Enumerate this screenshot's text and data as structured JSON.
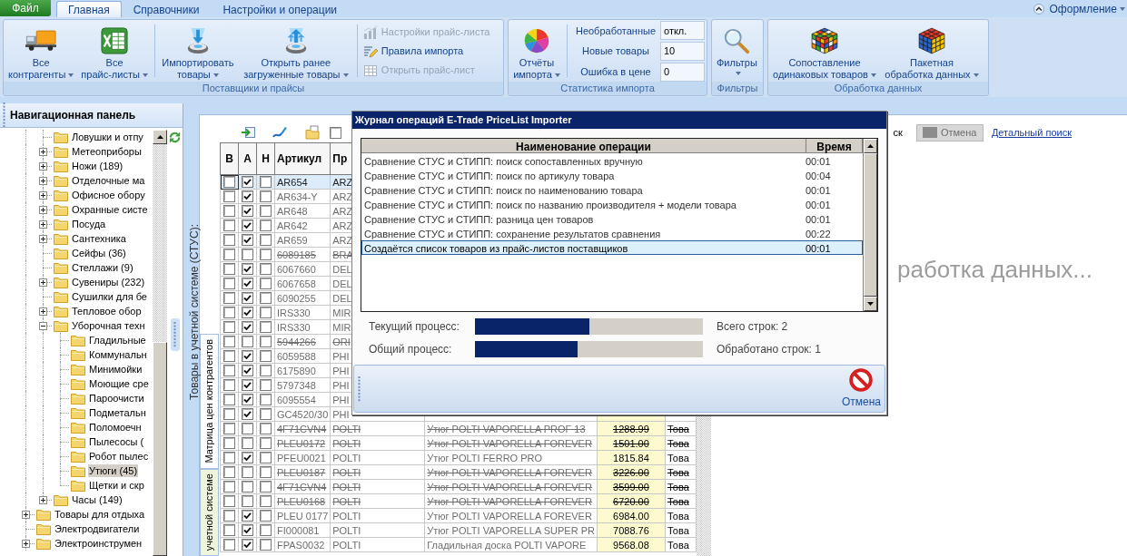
{
  "file_button": {
    "label": "Файл"
  },
  "tabs": [
    {
      "label": "Главная",
      "selected": true
    },
    {
      "label": "Справочники",
      "selected": false
    },
    {
      "label": "Настройки и операции",
      "selected": false
    }
  ],
  "appearance_menu": {
    "label": "Оформление"
  },
  "ribbon": [
    {
      "title": "Поставщики и прайсы",
      "sections": [
        {
          "kind": "large",
          "buttons": [
            {
              "lines": [
                "Все",
                "контрагенты"
              ]
            },
            {
              "lines": [
                "Все",
                "прайс-листы"
              ]
            }
          ]
        },
        {
          "kind": "large",
          "buttons": [
            {
              "lines": [
                "Импортировать",
                "товары"
              ]
            },
            {
              "lines": [
                "Открыть ранее",
                "загруженные товары"
              ]
            }
          ]
        },
        {
          "kind": "small",
          "buttons": [
            {
              "label": "Настройки прайс-листа",
              "disabled": true
            },
            {
              "label": "Правила импорта",
              "disabled": false
            },
            {
              "label": "Открыть прайс-лист",
              "disabled": true
            }
          ]
        }
      ]
    },
    {
      "title": "Статистика импорта",
      "sections": [
        {
          "kind": "large",
          "buttons": [
            {
              "lines": [
                "Отчёты",
                "импорта"
              ]
            }
          ]
        },
        {
          "kind": "fields",
          "fields": [
            {
              "label": "Необработанные",
              "value": "откл."
            },
            {
              "label": "Новые товары",
              "value": "10"
            },
            {
              "label": "Ошибка в цене",
              "value": "0"
            }
          ]
        }
      ]
    },
    {
      "title": "Фильтры",
      "sections": [
        {
          "kind": "large",
          "buttons": [
            {
              "lines": [
                "Фильтры"
              ]
            }
          ]
        }
      ]
    },
    {
      "title": "Обработка данных",
      "sections": [
        {
          "kind": "large",
          "buttons": [
            {
              "lines": [
                "Сопоставление",
                "одинаковых товаров"
              ]
            },
            {
              "lines": [
                "Пакетная",
                "обработка данных"
              ]
            }
          ]
        }
      ]
    }
  ],
  "navigation": {
    "title": "Навигационная панель",
    "tree": [
      {
        "children": [
          {
            "label": "Ловушки и отпу",
            "selected": false
          },
          {
            "label": "Метеоприборы",
            "expanded": false,
            "selected": false
          },
          {
            "label": "Ножи (189)",
            "expanded": false,
            "selected": false
          },
          {
            "label": "Отделочные ма",
            "expanded": false,
            "selected": false
          },
          {
            "label": "Офисное обору",
            "expanded": false,
            "selected": false
          },
          {
            "label": "Охранные систе",
            "expanded": false,
            "selected": false
          },
          {
            "label": "Посуда",
            "expanded": false,
            "selected": false
          },
          {
            "label": "Сантехника",
            "expanded": false,
            "selected": false
          },
          {
            "label": "Сейфы (36)",
            "selected": false
          },
          {
            "label": "Стеллажи (9)",
            "selected": false
          },
          {
            "label": "Сувениры (232)",
            "expanded": false,
            "selected": false
          },
          {
            "label": "Сушилки для бе",
            "selected": false
          },
          {
            "label": "Тепловое обор",
            "expanded": false,
            "selected": false
          },
          {
            "label": "Уборочная техн",
            "expanded": true,
            "selected": false,
            "children": [
              {
                "label": "Гладильные",
                "selected": false
              },
              {
                "label": "Коммунальн",
                "selected": false
              },
              {
                "label": "Минимойки",
                "selected": false
              },
              {
                "label": "Моющие сре",
                "selected": false
              },
              {
                "label": "Пароочисти",
                "selected": false
              },
              {
                "label": "Подметальн",
                "selected": false
              },
              {
                "label": "Поломоечн",
                "selected": false
              },
              {
                "label": "Пылесосы (",
                "selected": false
              },
              {
                "label": "Робот пылес",
                "selected": false
              },
              {
                "label": "Утюги (45)",
                "selected": true
              },
              {
                "label": "Щетки и скр",
                "selected": false
              }
            ]
          },
          {
            "label": "Часы (149)",
            "expanded": false,
            "selected": false
          }
        ]
      },
      {
        "label": "Товары для отдыха",
        "expanded": false,
        "selected": false
      },
      {
        "label": "Электродвигатели",
        "selected": false
      },
      {
        "label": "Электроинструмен",
        "expanded": false,
        "selected": false
      }
    ]
  },
  "main": {
    "side_label": "Товары в учетной системе (СТУС):",
    "side_tabs": [
      {
        "label": "Матрица цен контрагентов",
        "selected": true
      },
      {
        "label": "учетной системе",
        "selected": false
      }
    ],
    "toolbar": {
      "checkbox": {
        "checked": false
      },
      "search_label": "ск",
      "cancel_button": {
        "label": "Отмена",
        "disabled": true
      },
      "detail_search_link": "Детальный поиск"
    },
    "status_text": "работка данных...",
    "table": {
      "check_columns": [
        "В",
        "А",
        "Н"
      ],
      "columns": [
        "Артикул",
        "Пр"
      ],
      "rows": [
        {
          "checks": [
            false,
            true,
            false
          ],
          "cells": [
            "AR654",
            "ARZ"
          ],
          "crossed_out": false,
          "selected": true
        },
        {
          "checks": [
            false,
            true,
            false
          ],
          "cells": [
            "AR634-Y",
            "ARZ"
          ],
          "crossed_out": false,
          "selected": false
        },
        {
          "checks": [
            false,
            true,
            false
          ],
          "cells": [
            "AR648",
            "ARZ"
          ],
          "crossed_out": false,
          "selected": false
        },
        {
          "checks": [
            false,
            true,
            false
          ],
          "cells": [
            "AR642",
            "ARZ"
          ],
          "crossed_out": false,
          "selected": false
        },
        {
          "checks": [
            false,
            true,
            false
          ],
          "cells": [
            "AR659",
            "ARZ"
          ],
          "crossed_out": false,
          "selected": false
        },
        {
          "checks": [
            false,
            false,
            false
          ],
          "cells": [
            "6089185",
            "BRA"
          ],
          "crossed_out": true,
          "selected": false
        },
        {
          "checks": [
            false,
            true,
            false
          ],
          "cells": [
            "6067660",
            "DEL"
          ],
          "crossed_out": false,
          "selected": false
        },
        {
          "checks": [
            false,
            true,
            false
          ],
          "cells": [
            "6067658",
            "DEL"
          ],
          "crossed_out": false,
          "selected": false
        },
        {
          "checks": [
            false,
            true,
            false
          ],
          "cells": [
            "6090255",
            "DEL"
          ],
          "crossed_out": false,
          "selected": false
        },
        {
          "checks": [
            false,
            true,
            false
          ],
          "cells": [
            "IRS330",
            "MIR"
          ],
          "crossed_out": false,
          "selected": false
        },
        {
          "checks": [
            false,
            true,
            false
          ],
          "cells": [
            "IRS330",
            "MIR"
          ],
          "crossed_out": false,
          "selected": false
        },
        {
          "checks": [
            false,
            false,
            false
          ],
          "cells": [
            "5944266",
            "ORI"
          ],
          "crossed_out": true,
          "selected": false
        },
        {
          "checks": [
            false,
            true,
            false
          ],
          "cells": [
            "6059588",
            "PHI"
          ],
          "crossed_out": false,
          "selected": false
        },
        {
          "checks": [
            false,
            true,
            false
          ],
          "cells": [
            "6175890",
            "PHI"
          ],
          "crossed_out": false,
          "selected": false
        },
        {
          "checks": [
            false,
            true,
            false
          ],
          "cells": [
            "5797348",
            "PHI"
          ],
          "crossed_out": false,
          "selected": false
        },
        {
          "checks": [
            false,
            true,
            false
          ],
          "cells": [
            "6095554",
            "PHI"
          ],
          "crossed_out": false,
          "selected": false
        },
        {
          "checks": [
            false,
            true,
            false
          ],
          "cells": [
            "GC4520/30",
            "PHI"
          ],
          "crossed_out": false,
          "selected": false
        },
        {
          "checks": [
            false,
            false,
            false
          ],
          "cells": [
            "4F71CVN4",
            "POLTI",
            "Утюг POLTI VAPORELLA PROF 13",
            "1288.99",
            "Това"
          ],
          "crossed_out": true,
          "selected": false
        },
        {
          "checks": [
            false,
            false,
            false
          ],
          "cells": [
            "PLEU0172",
            "POLTI",
            "Утюг POLTI VAPORELLA FOREVER",
            "1501.00",
            "Това"
          ],
          "crossed_out": true,
          "selected": false
        },
        {
          "checks": [
            false,
            true,
            false
          ],
          "cells": [
            "PFEU0021",
            "POLTI",
            "Утюг POLTI FERRO PRO",
            "1815.84",
            "Това"
          ],
          "crossed_out": false,
          "selected": false
        },
        {
          "checks": [
            false,
            false,
            false
          ],
          "cells": [
            "PLEU0187",
            "POLTI",
            "Утюг POLTI VAPORELLA FOREVER",
            "3226.00",
            "Това"
          ],
          "crossed_out": true,
          "selected": false
        },
        {
          "checks": [
            false,
            false,
            false
          ],
          "cells": [
            "4F71CVN4",
            "POLTI",
            "Утюг POLTI VAPORELLA FOREVER",
            "3599.00",
            "Това"
          ],
          "crossed_out": true,
          "selected": false
        },
        {
          "checks": [
            false,
            false,
            false
          ],
          "cells": [
            "PLEU0168",
            "POLTI",
            "Утюг POLTI VAPORELLA FOREVER",
            "6720.00",
            "Това"
          ],
          "crossed_out": true,
          "selected": false
        },
        {
          "checks": [
            false,
            true,
            false
          ],
          "cells": [
            "PLEU 0177",
            "POLTI",
            "Утюг POLTI VAPORELLA FOREVER",
            "6984.00",
            "Това"
          ],
          "crossed_out": false,
          "selected": false
        },
        {
          "checks": [
            false,
            true,
            false
          ],
          "cells": [
            "FI000081",
            "POLTI",
            "Утюг POLTI VAPORELLA SUPER PR",
            "7088.76",
            "Това"
          ],
          "crossed_out": false,
          "selected": false
        },
        {
          "checks": [
            false,
            true,
            false
          ],
          "cells": [
            "FPAS0032",
            "POLTI",
            "Гладильная доска POLTI VAPORE",
            "9568.08",
            "Това"
          ],
          "crossed_out": false,
          "selected": false
        }
      ]
    }
  },
  "dialog": {
    "title": "Журнал операций E-Trade PriceList Importer",
    "columns": [
      "Наименование операции",
      "Время"
    ],
    "rows": [
      {
        "operation": "Сравнение СТУС и СТИПП: поиск сопоставленных вручную",
        "time": "00:01",
        "selected": false
      },
      {
        "operation": "Сравнение СТУС и СТИПП: поиск по артикулу товара",
        "time": "00:04",
        "selected": false
      },
      {
        "operation": "Сравнение СТУС и СТИПП: поиск по наименованию товара",
        "time": "00:01",
        "selected": false
      },
      {
        "operation": "Сравнение СТУС и СТИПП: поиск по названию производителя + модели товара",
        "time": "00:01",
        "selected": false
      },
      {
        "operation": "Сравнение СТУС и СТИПП: разница цен товаров",
        "time": "00:01",
        "selected": false
      },
      {
        "operation": "Сравнение СТУС и СТИПП: сохранение результатов сравнения",
        "time": "00:22",
        "selected": false
      },
      {
        "operation": "Создаётся список товаров из прайс-листов поставщиков",
        "time": "00:01",
        "selected": true
      }
    ],
    "progress": [
      {
        "label": "Текущий процесс:",
        "level": 0.5,
        "info": "Всего строк: 2"
      },
      {
        "label": "Общий процесс:",
        "level": 0.45,
        "info": "Обработано строк: 1"
      }
    ],
    "cancel_button": {
      "label": "Отмена"
    }
  }
}
